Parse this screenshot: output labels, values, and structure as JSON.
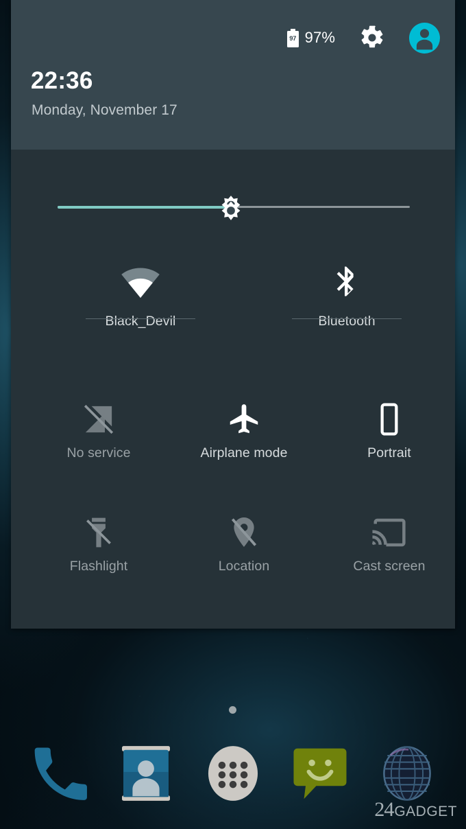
{
  "status_bar": {
    "battery_level_text": "97",
    "battery_percent": "97%",
    "battery_icon": "battery-icon",
    "settings_icon": "gear-icon",
    "avatar_icon": "user-avatar-icon",
    "avatar_color": "#00bcd4"
  },
  "header": {
    "time": "22:36",
    "date": "Monday, November 17",
    "background_color": "#37474f"
  },
  "panel": {
    "background_color": "#263238"
  },
  "brightness": {
    "name": "brightness-slider",
    "icon": "brightness-sun-icon",
    "value_percent": 48,
    "fill_color": "#80cbc4",
    "track_color": "#8d9599"
  },
  "tiles": [
    {
      "id": "wifi",
      "label": "Black_Devil",
      "icon": "wifi-icon",
      "state": "on",
      "has_rule": true
    },
    {
      "id": "bluetooth",
      "label": "Bluetooth",
      "icon": "bluetooth-icon",
      "state": "on",
      "has_rule": true
    },
    {
      "id": "cellular",
      "label": "No service",
      "icon": "signal-off-icon",
      "state": "off",
      "has_rule": false
    },
    {
      "id": "airplane_mode",
      "label": "Airplane mode",
      "icon": "airplane-icon",
      "state": "on",
      "has_rule": false
    },
    {
      "id": "rotation",
      "label": "Portrait",
      "icon": "phone-portrait-icon",
      "state": "on",
      "has_rule": false
    },
    {
      "id": "flashlight",
      "label": "Flashlight",
      "icon": "flashlight-off-icon",
      "state": "off",
      "has_rule": false
    },
    {
      "id": "location",
      "label": "Location",
      "icon": "location-off-icon",
      "state": "off",
      "has_rule": false
    },
    {
      "id": "cast_screen",
      "label": "Cast screen",
      "icon": "cast-screen-icon",
      "state": "off",
      "has_rule": false
    }
  ],
  "home": {
    "page_indicator_dots": 1,
    "dock": [
      {
        "id": "phone",
        "icon": "phone-handset-icon"
      },
      {
        "id": "contacts",
        "icon": "contacts-card-icon"
      },
      {
        "id": "app_drawer",
        "icon": "app-drawer-icon"
      },
      {
        "id": "messaging",
        "icon": "messaging-smiley-icon"
      },
      {
        "id": "browser",
        "icon": "browser-globe-icon"
      }
    ]
  },
  "watermark": {
    "number": "24",
    "word": "GADGET"
  }
}
